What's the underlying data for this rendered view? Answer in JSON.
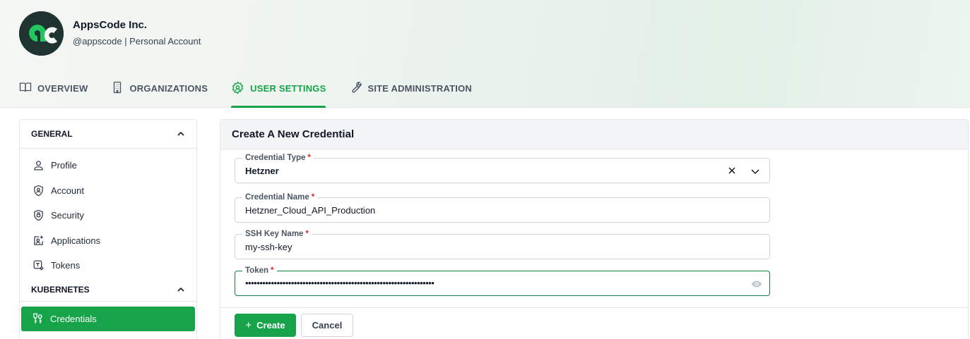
{
  "org": {
    "name": "AppsCode Inc.",
    "subtitle": "@appscode | Personal Account"
  },
  "nav": {
    "items": [
      {
        "label": "OVERVIEW",
        "icon": "book-open-icon",
        "active": false
      },
      {
        "label": "ORGANIZATIONS",
        "icon": "building-icon",
        "active": false
      },
      {
        "label": "USER SETTINGS",
        "icon": "gear-icon",
        "active": true
      },
      {
        "label": "SITE ADMINISTRATION",
        "icon": "wrench-icon",
        "active": false
      }
    ]
  },
  "sidebar": {
    "general": {
      "title": "GENERAL",
      "items": [
        {
          "label": "Profile",
          "icon": "user-icon"
        },
        {
          "label": "Account",
          "icon": "shield-user-icon"
        },
        {
          "label": "Security",
          "icon": "shield-lock-icon"
        },
        {
          "label": "Applications",
          "icon": "app-icon"
        },
        {
          "label": "Tokens",
          "icon": "token-icon"
        }
      ]
    },
    "kubernetes": {
      "title": "KUBERNETES",
      "items": [
        {
          "label": "Credentials",
          "icon": "credentials-icon",
          "active": true
        }
      ]
    }
  },
  "form": {
    "title": "Create A New Credential",
    "credential_type": {
      "label": "Credential Type",
      "required_mark": "*",
      "value": "Hetzner"
    },
    "credential_name": {
      "label": "Credential Name",
      "required_mark": "*",
      "value": "Hetzner_Cloud_API_Production"
    },
    "ssh_key_name": {
      "label": "SSH Key Name",
      "required_mark": "*",
      "value": "my-ssh-key"
    },
    "token": {
      "label": "Token",
      "required_mark": "*",
      "value": "••••••••••••••••••••••••••••••••••••••••••••••••••••••••••••••••••"
    },
    "create_label": "Create",
    "create_icon": "plus-icon",
    "cancel_label": "Cancel"
  },
  "colors": {
    "accent": "#16a34a",
    "required": "#dc2626"
  }
}
